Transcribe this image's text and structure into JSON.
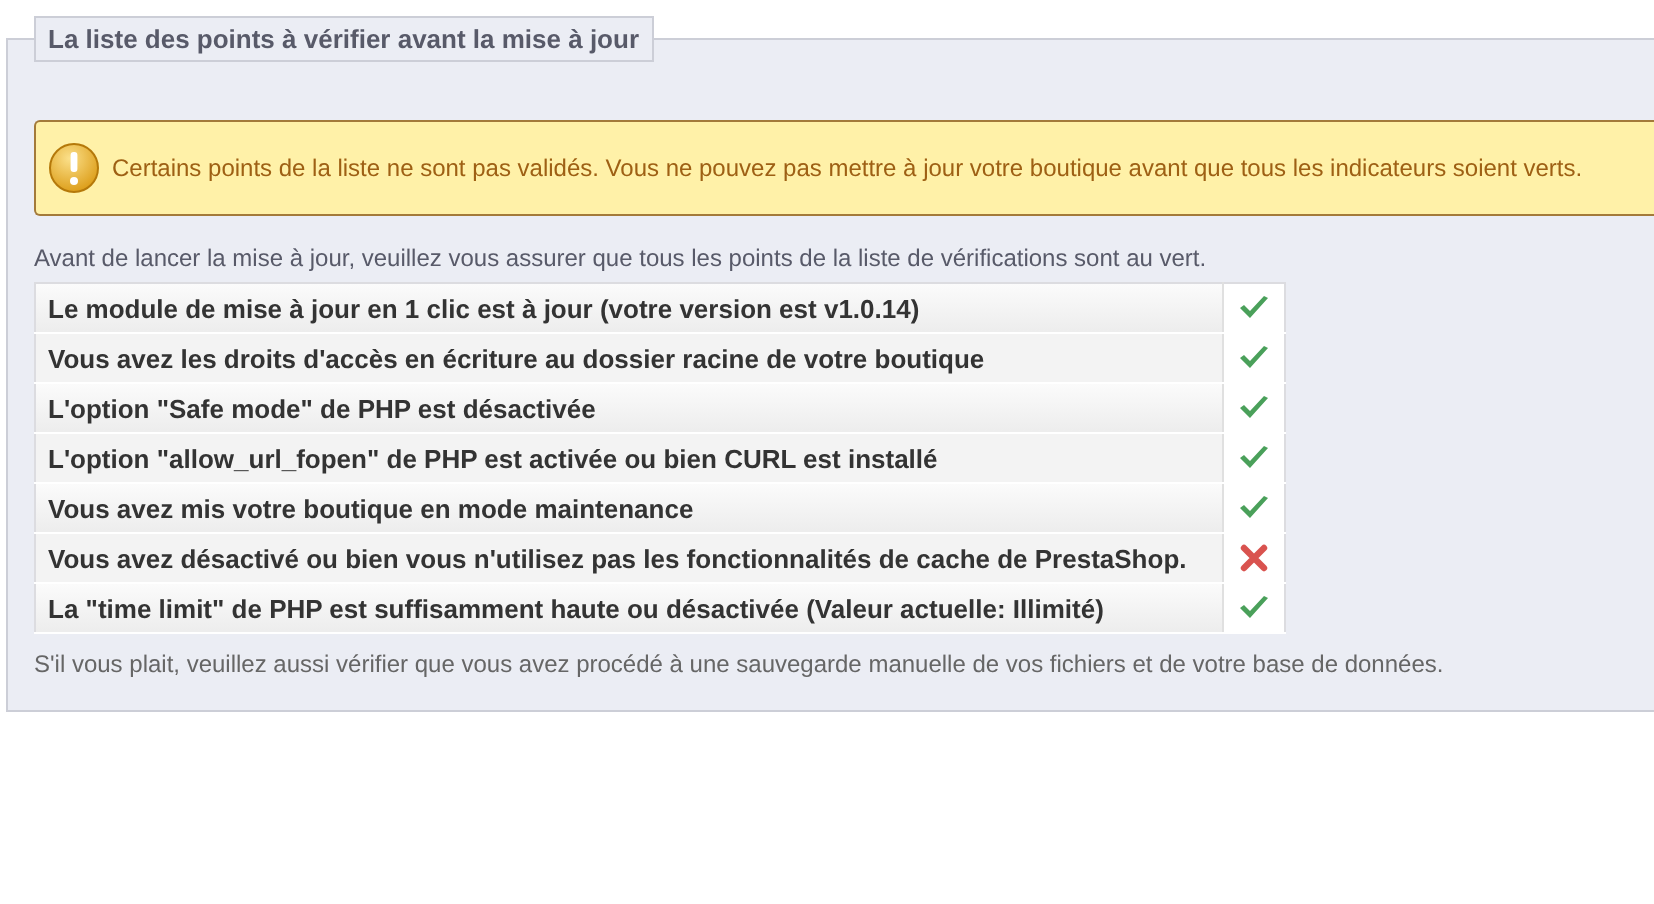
{
  "legend": "La liste des points à vérifier avant la mise à jour",
  "warning": "Certains points de la liste ne sont pas validés. Vous ne pouvez pas mettre à jour votre boutique avant que tous les indicateurs soient verts.",
  "intro": "Avant de lancer la mise à jour, veuillez vous assurer que tous les points de la liste de vérifications sont au vert.",
  "checks": [
    {
      "label": "Le module de mise à jour en 1 clic est à jour (votre version est v1.0.14)",
      "ok": true
    },
    {
      "label": "Vous avez les droits d'accès en écriture au dossier racine de votre boutique",
      "ok": true
    },
    {
      "label": "L'option \"Safe mode\" de PHP est désactivée",
      "ok": true
    },
    {
      "label": "L'option \"allow_url_fopen\" de PHP est activée ou bien CURL est installé",
      "ok": true
    },
    {
      "label": "Vous avez mis votre boutique en mode maintenance",
      "ok": true
    },
    {
      "label": "Vous avez désactivé ou bien vous n'utilisez pas les fonctionnalités de cache de PrestaShop.",
      "ok": false
    },
    {
      "label": "La \"time limit\" de PHP est suffisamment haute ou désactivée (Valeur actuelle: Illimité)",
      "ok": true
    }
  ],
  "footer": "S'il vous plait, veuillez aussi vérifier que vous avez procédé à une sauvegarde manuelle de vos fichiers et de votre base de données."
}
